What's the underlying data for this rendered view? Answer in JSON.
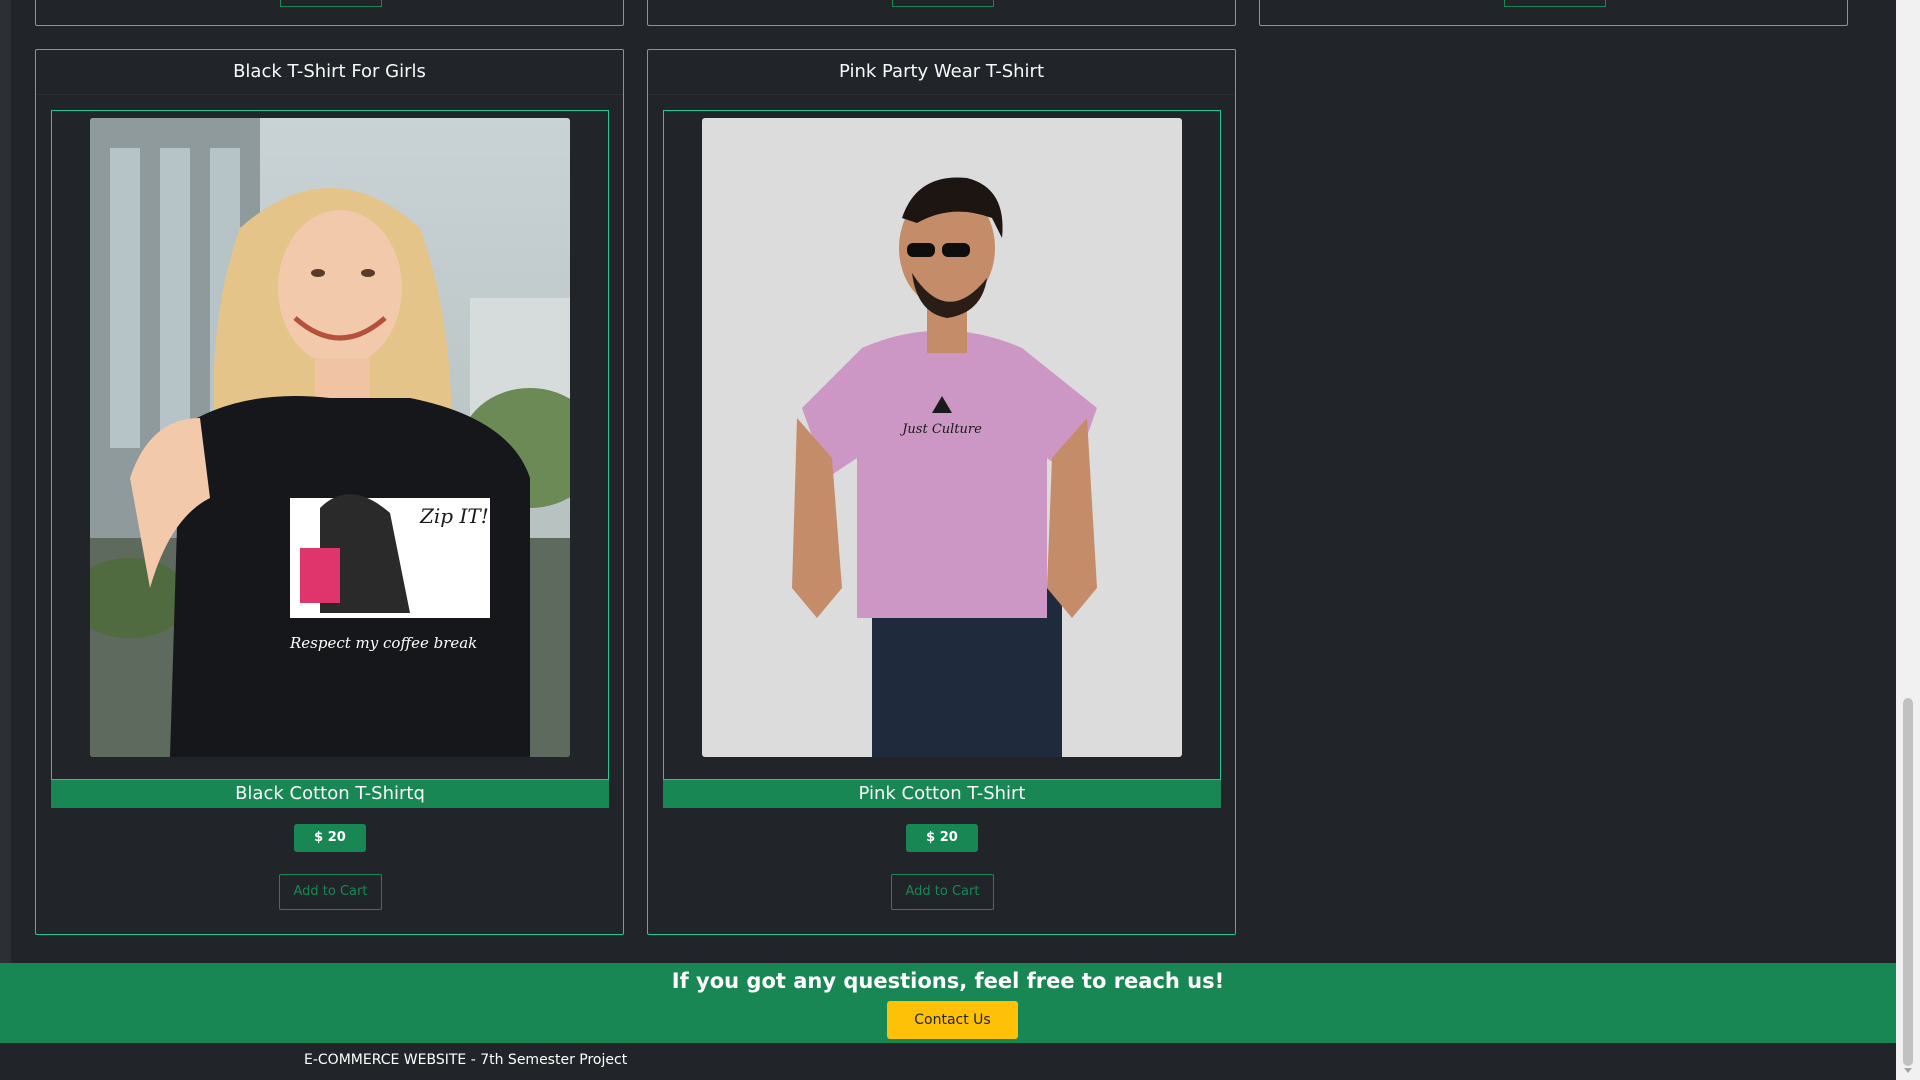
{
  "products": [
    {
      "title": "Black T-Shirt For Girls",
      "name": "Black Cotton T-Shirtq",
      "price": "$ 20",
      "cart_label": "Add to Cart",
      "tee_print": "Zip IT!",
      "tee_caption": "Respect my coffee break"
    },
    {
      "title": "Pink Party Wear T-Shirt",
      "name": "Pink Cotton T-Shirt",
      "price": "$ 20",
      "cart_label": "Add to Cart",
      "tee_print": "Just Culture"
    }
  ],
  "footer": {
    "cta_title": "If you got any questions, feel free to reach us!",
    "contact_label": "Contact Us",
    "bottom_text": "E-COMMERCE WEBSITE - 7th Semester Project"
  },
  "colors": {
    "background": "#212529",
    "accent_border": "#20c997",
    "success": "#198754",
    "warning": "#ffc107"
  }
}
